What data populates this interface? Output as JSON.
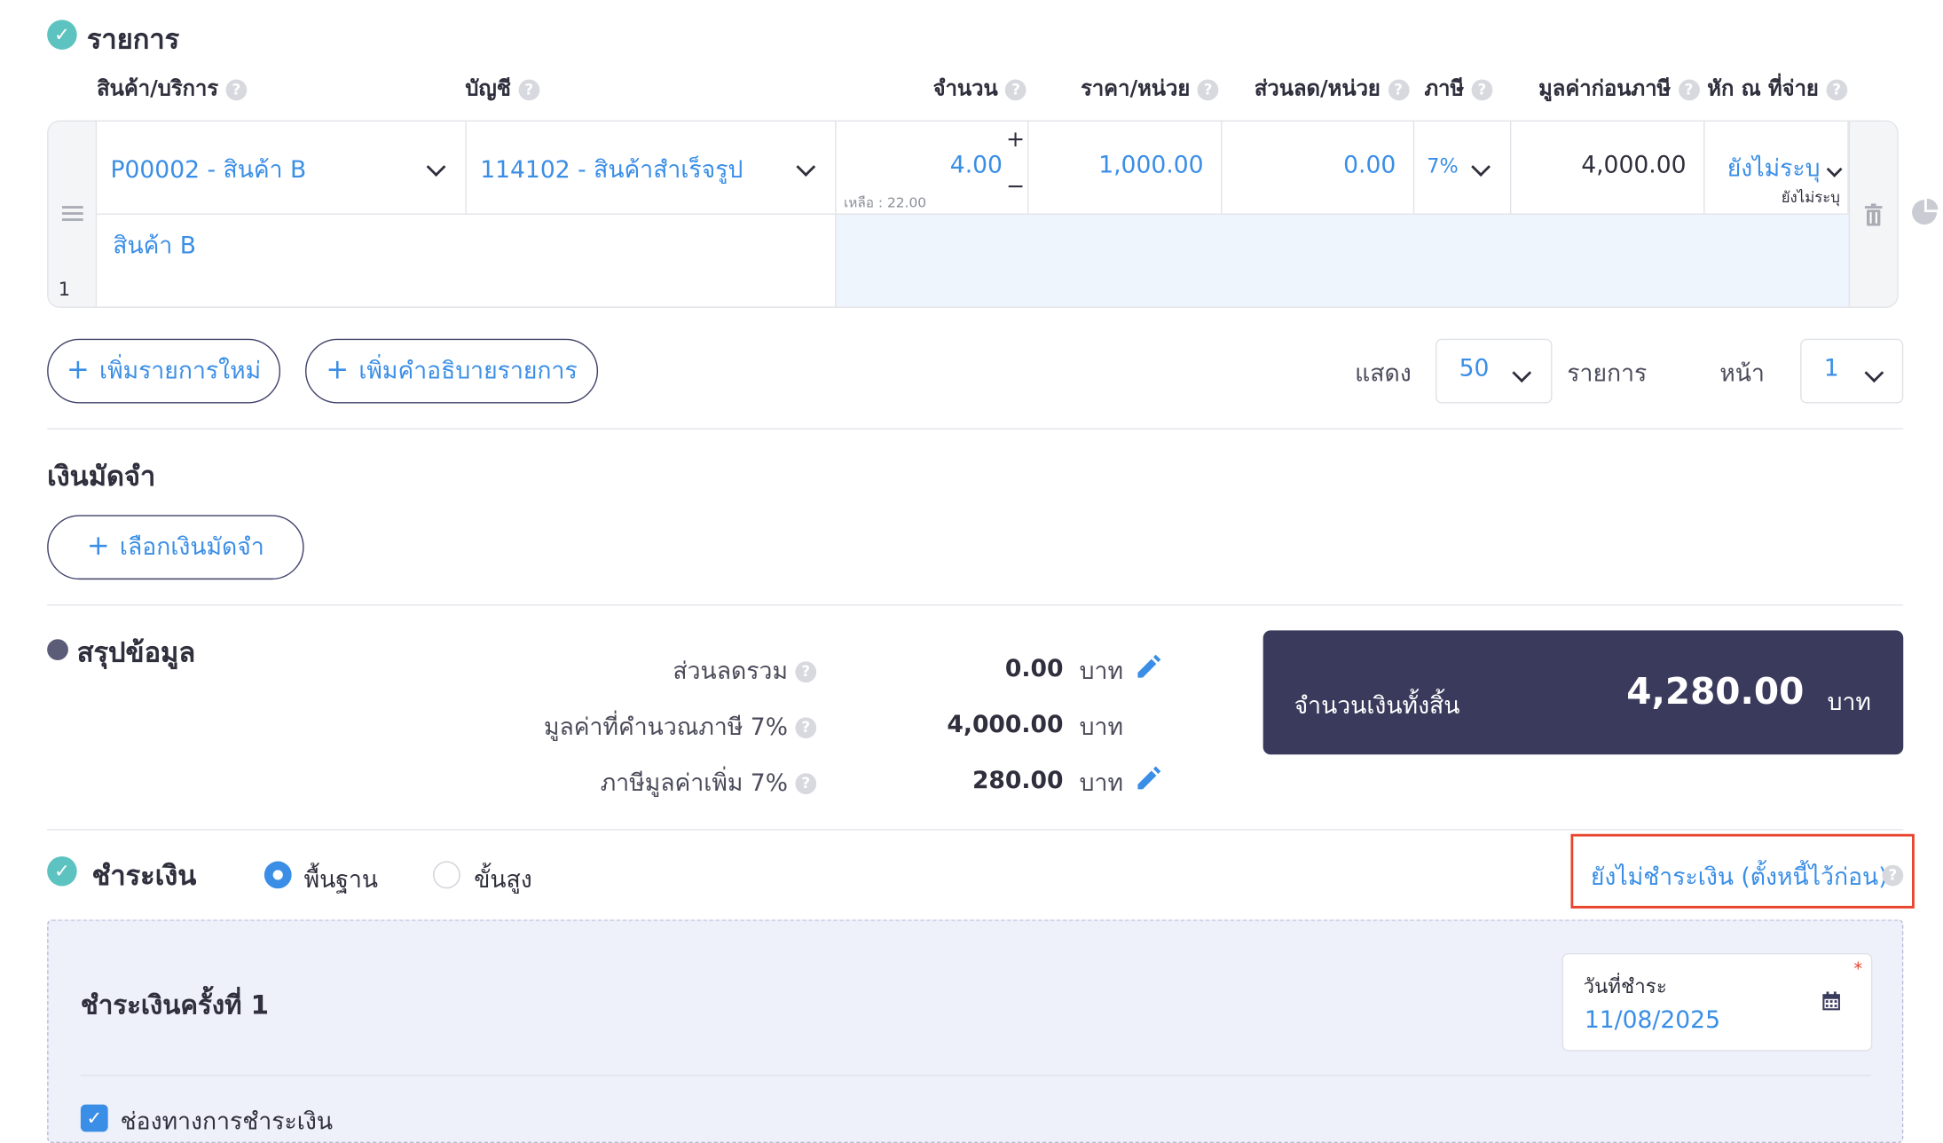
{
  "items_section": {
    "title": "รายการ",
    "columns": [
      "สินค้า/บริการ",
      "บัญชี",
      "จำนวน",
      "ราคา/หน่วย",
      "ส่วนลด/หน่วย",
      "ภาษี",
      "มูลค่าก่อนภาษี",
      "หัก ณ ที่จ่าย"
    ],
    "row": {
      "index": "1",
      "product": "P00002 - สินค้า B",
      "account": "114102 - สินค้าสำเร็จรูป",
      "quantity": "4.00",
      "remaining": "เหลือ : 22.00",
      "qty_plus": "+",
      "qty_minus": "−",
      "price": "1,000.00",
      "discount": "0.00",
      "tax": "7%",
      "pre_tax": "4,000.00",
      "withholding": "ยังไม่ระบุ",
      "withholding_sub": "ยังไม่ระบุ",
      "description": "สินค้า B"
    },
    "add_item_label": "เพิ่มรายการใหม่",
    "add_desc_label": "เพิ่มคำอธิบายรายการ",
    "show_label": "แสดง",
    "per_page": "50",
    "items_label": "รายการ",
    "page_label": "หน้า",
    "page": "1"
  },
  "deposit": {
    "title": "เงินมัดจำ",
    "select_label": "เลือกเงินมัดจำ"
  },
  "summary": {
    "title": "สรุปข้อมูล",
    "discount_label": "ส่วนลดรวม",
    "discount_value": "0.00",
    "taxable_label": "มูลค่าที่คำนวณภาษี 7%",
    "taxable_value": "4,000.00",
    "vat_label": "ภาษีมูลค่าเพิ่ม 7%",
    "vat_value": "280.00",
    "unit": "บาท",
    "total_label": "จำนวนเงินทั้งสิ้น",
    "total_value": "4,280.00",
    "total_unit": "บาท"
  },
  "payment": {
    "title": "ชำระเงิน",
    "mode_basic": "พื้นฐาน",
    "mode_advanced": "ขั้นสูง",
    "unpaid_link": "ยังไม่ชำระเงิน (ตั้งหนี้ไว้ก่อน)",
    "installment_title": "ชำระเงินครั้งที่ 1",
    "date_label": "วันที่ชำระ",
    "date_required": "*",
    "date_value": "11/08/2025",
    "channel_label": "ช่องทางการชำระเงิน"
  },
  "colors": {
    "accent": "#3a8ee6",
    "dark": "#3a3b5c",
    "teal": "#5dc3c0",
    "highlight": "#e8432e"
  }
}
